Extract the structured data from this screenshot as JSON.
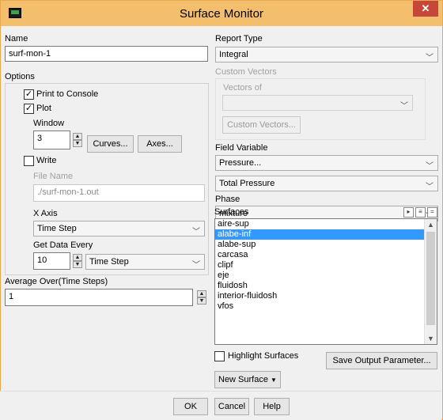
{
  "window": {
    "title": "Surface Monitor",
    "close_glyph": "✕"
  },
  "name": {
    "label": "Name",
    "value": "surf-mon-1"
  },
  "options": {
    "label": "Options",
    "print_to_console": "Print to Console",
    "plot": "Plot",
    "window_label": "Window",
    "window_value": "3",
    "curves_button": "Curves...",
    "axes_button": "Axes...",
    "write": "Write",
    "file_name_label": "File Name",
    "file_name_value": "./surf-mon-1.out",
    "x_axis_label": "X Axis",
    "x_axis_value": "Time Step",
    "get_data_every_label": "Get Data Every",
    "get_data_every_value": "10",
    "get_data_every_unit": "Time Step",
    "average_over_label": "Average Over(Time Steps)",
    "average_over_value": "1"
  },
  "report_type": {
    "label": "Report Type",
    "value": "Integral"
  },
  "custom_vectors": {
    "label": "Custom Vectors",
    "vectors_of_label": "Vectors of",
    "vectors_of_value": "",
    "button": "Custom Vectors..."
  },
  "field_variable": {
    "label": "Field Variable",
    "category": "Pressure...",
    "value": "Total Pressure"
  },
  "phase": {
    "label": "Phase",
    "value": "mixture"
  },
  "surfaces": {
    "label": "Surfaces",
    "items": [
      "aire-sup",
      "alabe-inf",
      "alabe-sup",
      "carcasa",
      "clipf",
      "eje",
      "fluidosh",
      "interior-fluidosh",
      "vfos"
    ],
    "selected_index": 1
  },
  "highlight_surfaces": "Highlight Surfaces",
  "save_output_parameter": "Save Output Parameter...",
  "new_surface": "New Surface",
  "footer": {
    "ok": "OK",
    "cancel": "Cancel",
    "help": "Help"
  },
  "checks": {
    "print_to_console": true,
    "plot": true,
    "write": false,
    "highlight_surfaces": false
  },
  "colors": {
    "titlebar": "#f3bf6c",
    "selection": "#3399ff",
    "close": "#c7463a"
  }
}
